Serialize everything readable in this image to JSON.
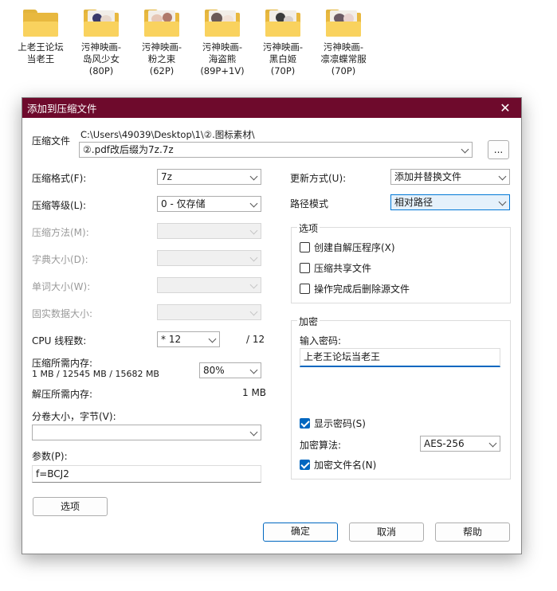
{
  "desktop": {
    "folders": [
      {
        "name_line1": "上老王论坛",
        "name_line2": "当老王",
        "name_line3": ""
      },
      {
        "name_line1": "污神映画-",
        "name_line2": "岛风少女",
        "name_line3": "(80P)"
      },
      {
        "name_line1": "污神映画-",
        "name_line2": "粉之束",
        "name_line3": "(62P)"
      },
      {
        "name_line1": "污神映画-",
        "name_line2": "海盗熊",
        "name_line3": "(89P+1V)"
      },
      {
        "name_line1": "污神映画-",
        "name_line2": "黑白姬",
        "name_line3": "(70P)"
      },
      {
        "name_line1": "污神映画-",
        "name_line2": "凛凛蝶常服",
        "name_line3": "(70P)"
      }
    ]
  },
  "dialog": {
    "title": "添加到压缩文件",
    "archive": {
      "label": "压缩文件",
      "path": "C:\\Users\\49039\\Desktop\\1\\②.图标素材\\",
      "name": "②.pdf改后缀为7z.7z",
      "browse_label": "..."
    },
    "left": {
      "format_label": "压缩格式(F):",
      "format_value": "7z",
      "level_label": "压缩等级(L):",
      "level_value": "0 - 仅存储",
      "method_label": "压缩方法(M):",
      "dict_label": "字典大小(D):",
      "word_label": "单词大小(W):",
      "solid_label": "固实数据大小:",
      "cpu_label": "CPU 线程数:",
      "cpu_value": "* 12",
      "cpu_total": "/ 12",
      "mem_label": "压缩所需内存:",
      "mem_detail": "1 MB / 12545 MB / 15682 MB",
      "mem_value": "80%",
      "decomp_label": "解压所需内存:",
      "decomp_value": "1 MB",
      "volume_label": "分卷大小，字节(V):",
      "volume_value": "",
      "params_label": "参数(P):",
      "params_value": "f=BCJ2",
      "options_button": "选项"
    },
    "right": {
      "update_label": "更新方式(U):",
      "update_value": "添加并替换文件",
      "path_label": "路径模式",
      "path_value": "相对路径",
      "options_group": "选项",
      "opt_sfx": "创建自解压程序(X)",
      "opt_shared": "压缩共享文件",
      "opt_delete": "操作完成后删除源文件",
      "encrypt_group": "加密",
      "password_label": "输入密码:",
      "password_value": "上老王论坛当老王",
      "show_password": "显示密码(S)",
      "enc_method_label": "加密算法:",
      "enc_method_value": "AES-256",
      "encrypt_names": "加密文件名(N)"
    },
    "buttons": {
      "ok": "确定",
      "cancel": "取消",
      "help": "帮助"
    }
  },
  "colors": {
    "titlebar": "#6e0a2c",
    "accent": "#0067c0",
    "folder": "#f9d25e"
  }
}
